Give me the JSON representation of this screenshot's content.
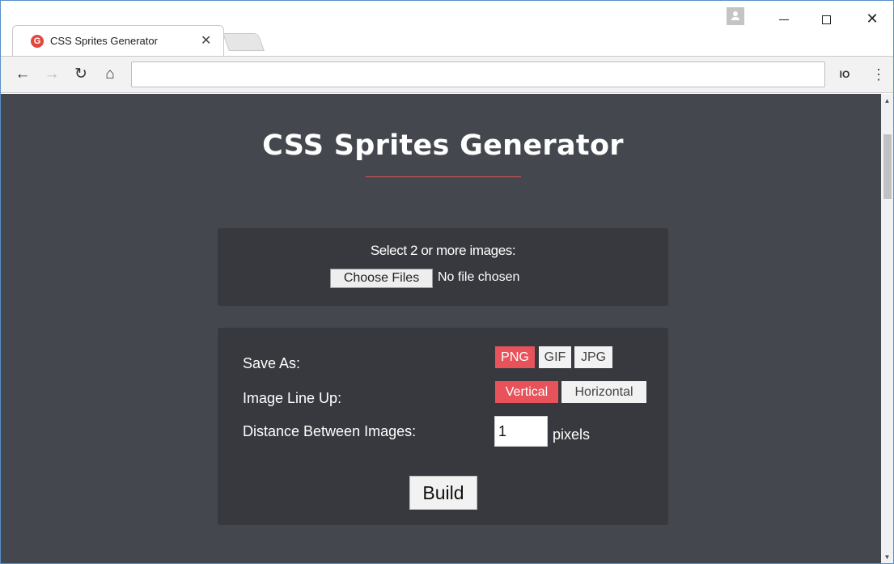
{
  "browser": {
    "tab_title": "CSS Sprites Generator",
    "tab_favicon": "G",
    "tab_close": "✕",
    "address": "",
    "extension_label": "IO"
  },
  "icons": {
    "favicon": "g-logo-icon",
    "close": "close-icon",
    "back": "arrow-left-icon",
    "forward": "arrow-right-icon",
    "reload": "reload-icon",
    "home": "home-icon",
    "menu": "kebab-menu-icon",
    "profile": "profile-icon"
  },
  "page": {
    "title": "CSS Sprites Generator",
    "upload": {
      "label": "Select 2 or more images:",
      "button": "Choose Files",
      "status": "No file chosen"
    },
    "options": {
      "save_as_label": "Save As:",
      "formats": [
        {
          "label": "PNG",
          "active": true
        },
        {
          "label": "GIF",
          "active": false
        },
        {
          "label": "JPG",
          "active": false
        }
      ],
      "lineup_label": "Image Line Up:",
      "lineups": [
        {
          "label": "Vertical",
          "active": true
        },
        {
          "label": "Horizontal",
          "active": false
        }
      ],
      "distance_label": "Distance Between Images:",
      "distance_value": "1",
      "distance_unit": "pixels",
      "build_button": "Build"
    }
  },
  "colors": {
    "background": "#44484e",
    "panel": "#37393e",
    "accent": "#e8525a",
    "favicon": "#e2473e"
  }
}
